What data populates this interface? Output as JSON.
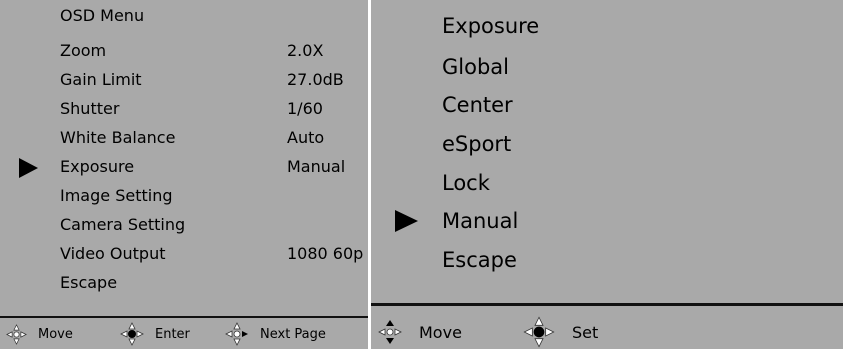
{
  "left_menu": {
    "title": "OSD Menu",
    "items": [
      {
        "label": "Zoom",
        "value": "2.0X"
      },
      {
        "label": "Gain Limit",
        "value": "27.0dB"
      },
      {
        "label": "Shutter",
        "value": "1/60"
      },
      {
        "label": "White Balance",
        "value": "Auto"
      },
      {
        "label": "Exposure",
        "value": "Manual"
      },
      {
        "label": "Image Setting",
        "value": ""
      },
      {
        "label": "Camera Setting",
        "value": ""
      },
      {
        "label": "Video Output",
        "value": "1080 60p"
      },
      {
        "label": "Escape",
        "value": ""
      }
    ],
    "selected_index": 4,
    "cursor_icon": "triangle-right-icon",
    "footer": [
      {
        "icon": "dpad-move-icon",
        "label": "Move"
      },
      {
        "icon": "dpad-enter-icon",
        "label": "Enter"
      },
      {
        "icon": "dpad-next-page-icon",
        "label": "Next Page"
      }
    ]
  },
  "right_menu": {
    "title": "Exposure",
    "items": [
      {
        "label": "Global"
      },
      {
        "label": "Center"
      },
      {
        "label": "eSport"
      },
      {
        "label": "Lock"
      },
      {
        "label": "Manual"
      },
      {
        "label": "Escape"
      }
    ],
    "selected_index": 4,
    "cursor_icon": "triangle-right-icon",
    "footer": [
      {
        "icon": "dpad-move-icon",
        "label": "Move"
      },
      {
        "icon": "dpad-set-icon",
        "label": "Set"
      }
    ]
  },
  "colors": {
    "panel_background": "#a9a9a9",
    "text": "#000000",
    "divider": "#111111"
  }
}
